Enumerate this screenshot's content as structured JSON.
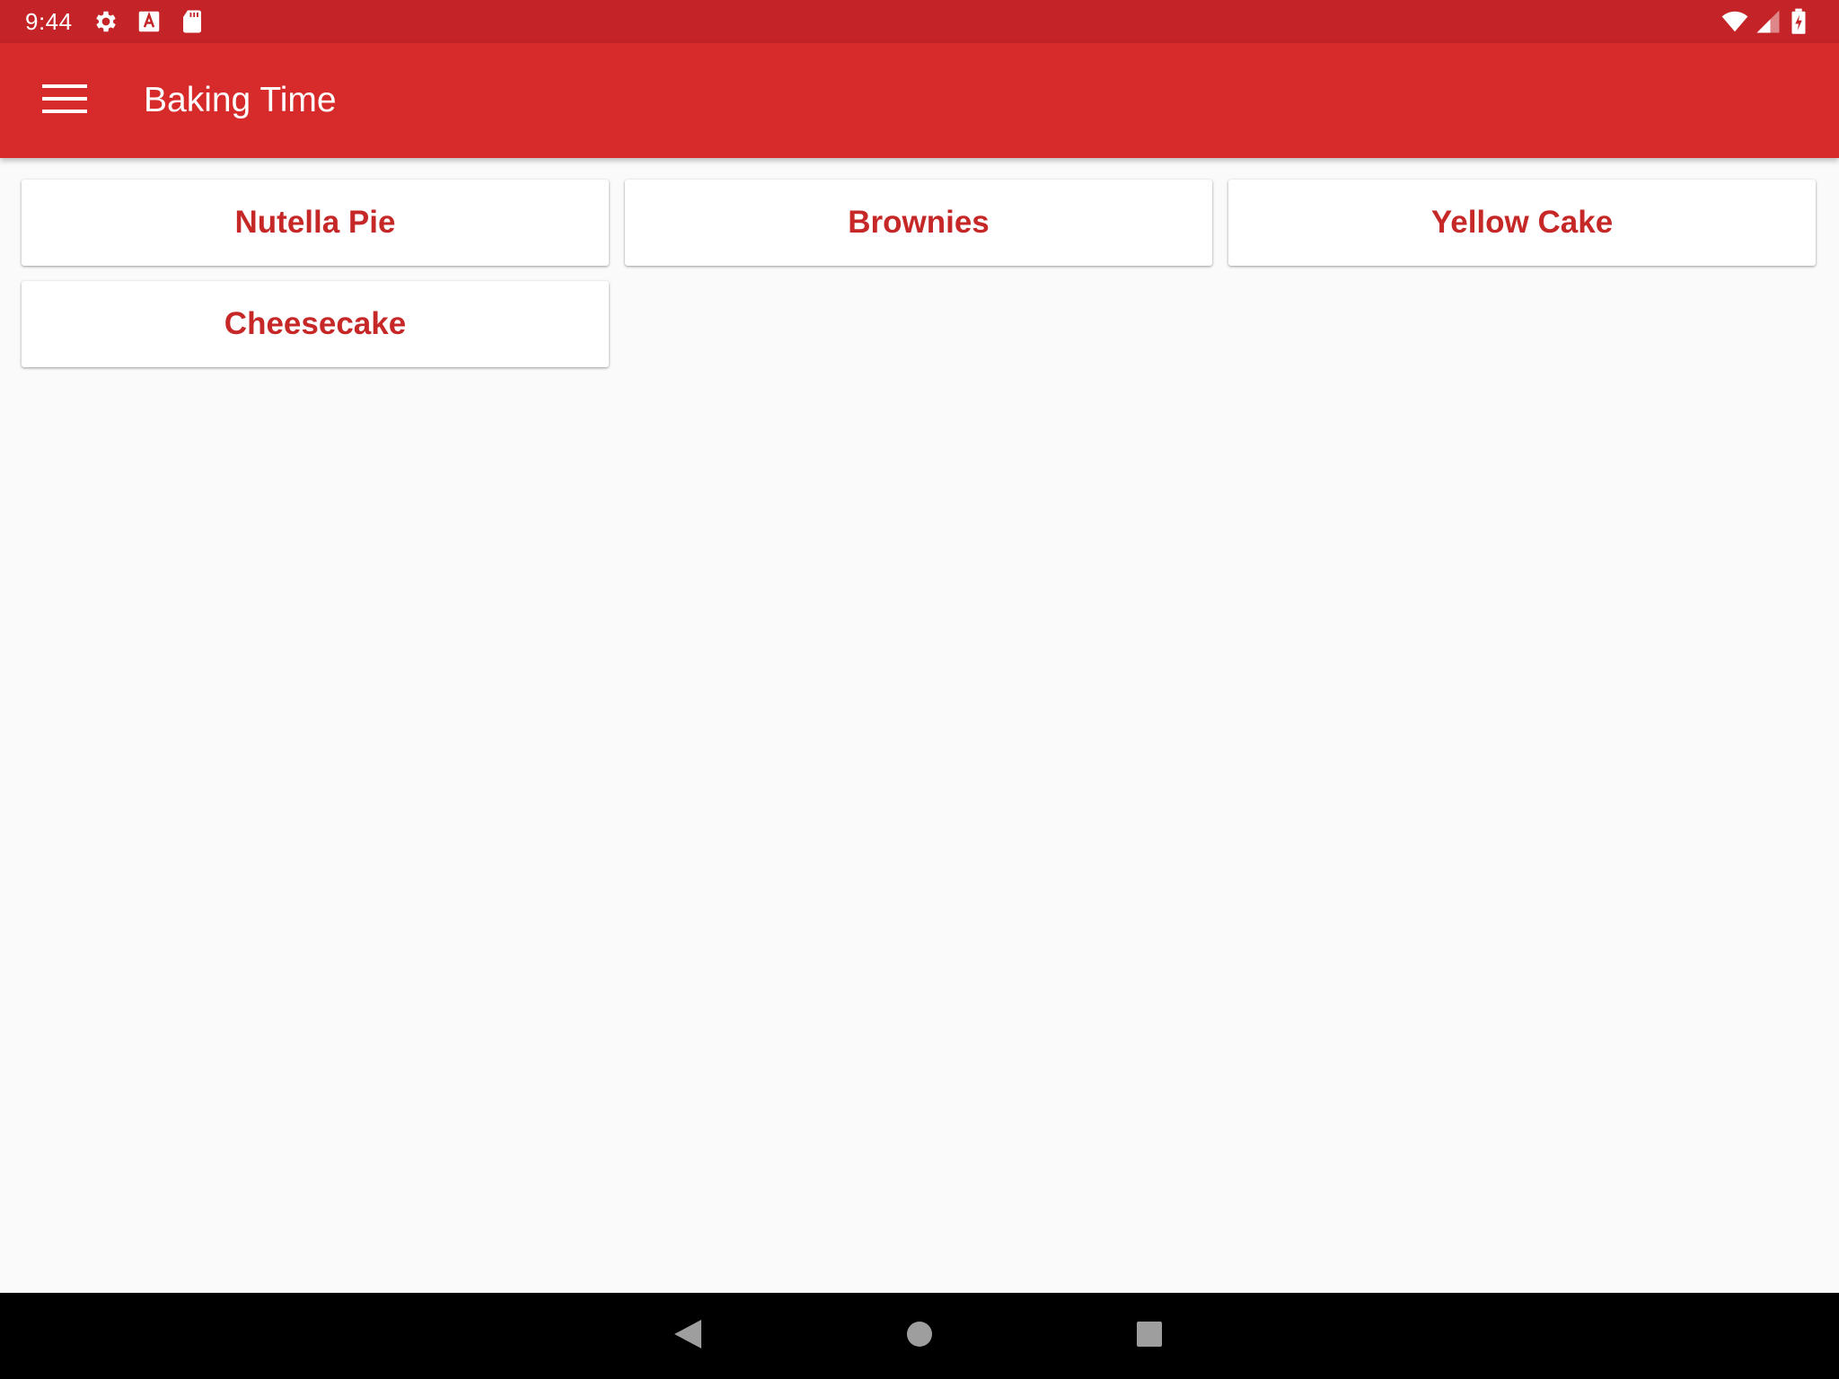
{
  "status_bar": {
    "time": "9:44",
    "left_icons": [
      "gear-icon",
      "a-letter-icon",
      "sd-card-icon"
    ],
    "right_icons": [
      "wifi-icon",
      "cell-signal-icon",
      "battery-charging-icon"
    ]
  },
  "app_bar": {
    "title": "Baking Time",
    "menu_icon": "hamburger-menu-icon",
    "background_color": "#d72b2b"
  },
  "recipes": [
    {
      "name": "Nutella Pie"
    },
    {
      "name": "Brownies"
    },
    {
      "name": "Yellow Cake"
    },
    {
      "name": "Cheesecake"
    }
  ],
  "colors": {
    "status_bar": "#c42427",
    "accent_text": "#c62828",
    "background": "#fafafa"
  },
  "nav_bar": {
    "buttons": [
      "back-icon",
      "home-icon",
      "recents-icon"
    ]
  }
}
